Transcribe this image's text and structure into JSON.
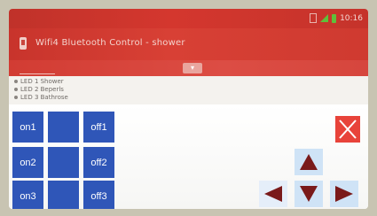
{
  "status_bar": {
    "time": "10:16",
    "icons": [
      "sim-icon",
      "signal-icon",
      "battery-icon"
    ]
  },
  "header": {
    "title": "Wifi4 Bluetooth Control - shower",
    "icon": "app-icon"
  },
  "led_list": [
    {
      "label": "LED 1 Shower"
    },
    {
      "label": "LED 2 Beperls"
    },
    {
      "label": "LED 3 Bathrose"
    }
  ],
  "controls": {
    "on": [
      "on1",
      "on2",
      "on3"
    ],
    "off": [
      "off1",
      "off2",
      "off3"
    ]
  },
  "colors": {
    "accent": "#d4372e",
    "button": "#2f56b8",
    "close": "#e8433a",
    "arrow": "#7a1a1a",
    "pad_bg": "#cfe3f6"
  }
}
